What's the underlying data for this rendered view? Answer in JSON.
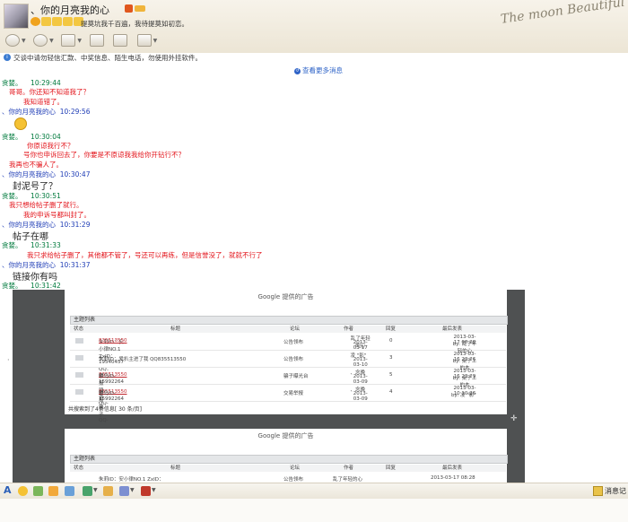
{
  "header": {
    "nickname": "、你的月亮我的心",
    "signature": "提莫坑我千百遍，我待提莫如初恋。",
    "deco_text": "The moon Beautiful"
  },
  "notice": {
    "text": "交谈中请勿轻信汇款、中奖信息、陌生电话，勿使用外挂软件。",
    "more_link": "查看更多消息"
  },
  "chat": {
    "m1_name": "贪婪。",
    "m1_time": "10:29:44",
    "m1_l1": "哥哥。你还知不知道我了？",
    "m1_l2": "我知道错了。",
    "m2_name": "、你的月亮我的心",
    "m2_time": "10:29:56",
    "m3_name": "贪婪。",
    "m3_time": "10:30:04",
    "m3_l1": "你原谅我行不？",
    "m3_l2": "号你也申诉回去了，你要是不原谅我我给你开钻行不？",
    "m3_l3": "我再也不骗人了。",
    "m4_name": "、你的月亮我的心",
    "m4_time": "10:30:47",
    "m4_text": "封泥号了？",
    "m5_name": "贪婪。",
    "m5_time": "10:30:51",
    "m5_l1": "我只想给帖子删了就行。",
    "m5_l2": "我的申诉号都叫封了。",
    "m6_name": "、你的月亮我的心",
    "m6_time": "10:31:29",
    "m6_text": "帖子在哪",
    "m7_name": "贪婪。",
    "m7_time": "10:31:33",
    "m7_text": "我只求给帖子删了，其他都不管了，号还可以再练，但是信誉没了，就就不行了",
    "m8_name": "、你的月亮我的心",
    "m8_time": "10:31:37",
    "m8_text": "链接你有吗",
    "m9_name": "贪婪。",
    "m9_time": "10:31:42"
  },
  "shot": {
    "ad": "Google 提供的广告",
    "table_title": "主题列表",
    "cols": [
      "状态",
      "标题",
      "论坛",
      "作者",
      "回复",
      "最后发表"
    ],
    "rows": [
      {
        "t1": "朱莉ID：安小律NO.1 ZxID：19540457 QQ：",
        "t2": "835513550",
        "forum": "公告领布",
        "author": "乱了年轻的心",
        "adate": "2013-03-17",
        "rep": "0",
        "last": "2013-03-17 08:28",
        "by": "by: 乱了年轻的心"
      },
      {
        "t1": "朱莉ID：爱扒主进了我  QQ835513550",
        "t2": "",
        "forum": "公告领布",
        "author": "凌 \"影\"",
        "adate": "2013-03-10",
        "rep": "3",
        "last": "2013-03-16 23:26",
        "by": "by: 桌子上的本"
      },
      {
        "t1": "举报骗子QQ-",
        "t2": "835513550",
        "t3": " 骗岛ID-15992264",
        "forum": "骗子曝光台",
        "author": "、念晚",
        "adate": "2013-03-09",
        "rep": "5",
        "last": "2013-03-16 23:29",
        "by": "by: 桌子上的本"
      },
      {
        "t1": "举报骗子QQ-",
        "t2": "835513550",
        "t3": " 骗岛ID-15992264",
        "forum": "交易举报",
        "author": "、念晚",
        "adate": "2013-03-09",
        "rep": "4",
        "last": "2013-03-10 10:26",
        "by": "by: 凌 \"影\""
      }
    ],
    "footer": "共搜索到了4条信息[ 30 条/页]",
    "row2_partial": {
      "t1": "朱莉ID：安小律NO.1 ZxID：",
      "forum": "公告领布",
      "author": "乱了年轻的心",
      "last": "2013-03-17 08:28"
    }
  },
  "bottom": {
    "history": "消息记"
  }
}
